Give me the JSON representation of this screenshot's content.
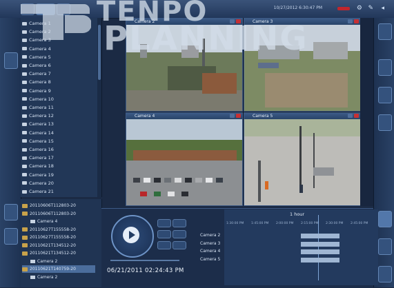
{
  "app": {
    "datetime": "10/27/2012 6:30:47 PM",
    "accent_color": "#3c5a86",
    "record_color": "#c0262d"
  },
  "watermark": {
    "line1": "TENPO",
    "line2": "PLANNING"
  },
  "camera_tree": {
    "items": [
      "Camera 1",
      "Camera 2",
      "Camera 3",
      "Camera 4",
      "Camera 5",
      "Camera 6",
      "Camera 7",
      "Camera 8",
      "Camera 9",
      "Camera 10",
      "Camera 11",
      "Camera 12",
      "Camera 13",
      "Camera 14",
      "Camera 15",
      "Camera 16",
      "Camera 17",
      "Camera 18",
      "Camera 19",
      "Camera 20",
      "Camera 21"
    ]
  },
  "recordings": {
    "items": [
      {
        "label": "20110606T112803-20",
        "type": "folder"
      },
      {
        "label": "20110606T112803-20",
        "type": "folder"
      },
      {
        "label": "Camera 4",
        "type": "camera"
      },
      {
        "label": "20110627T155558-20",
        "type": "folder"
      },
      {
        "label": "20110627T155558-20",
        "type": "folder"
      },
      {
        "label": "20110621T134512-20",
        "type": "folder"
      },
      {
        "label": "20110621T134512-20",
        "type": "folder"
      },
      {
        "label": "Camera 2",
        "type": "camera"
      },
      {
        "label": "20110621T140759-20",
        "type": "folder",
        "selected": true
      },
      {
        "label": "Camera 2",
        "type": "camera"
      }
    ]
  },
  "video_tiles": [
    {
      "title": "Camera 2"
    },
    {
      "title": "Camera 3"
    },
    {
      "title": "Camera 4"
    },
    {
      "title": "Camera 5"
    }
  ],
  "player": {
    "playback_time": "06/21/2011 02:24:43 PM"
  },
  "timeline": {
    "range_label": "1 hour",
    "tick_labels": [
      "1:30:00 PM",
      "1:45:00 PM",
      "2:00:00 PM",
      "2:15:00 PM",
      "2:30:00 PM",
      "2:45:00 PM"
    ],
    "rows": [
      "Camera 2",
      "Camera 3",
      "Camera 4",
      "Camera 5"
    ]
  }
}
